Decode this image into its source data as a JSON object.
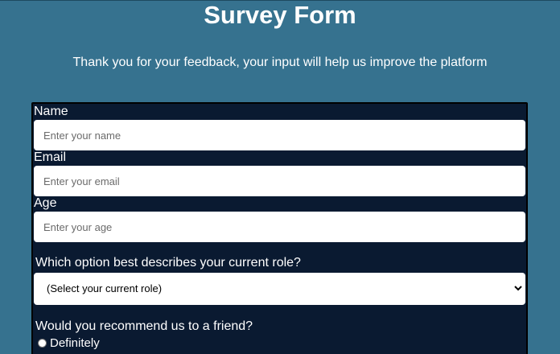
{
  "header": {
    "title": "Survey Form",
    "description": "Thank you for your feedback, your input will help us improve the platform"
  },
  "form": {
    "name": {
      "label": "Name",
      "placeholder": "Enter your name"
    },
    "email": {
      "label": "Email",
      "placeholder": "Enter your email"
    },
    "age": {
      "label": "Age",
      "placeholder": "Enter your age"
    },
    "role": {
      "question": "Which option best describes your current role?",
      "selected": "(Select your current role)"
    },
    "recommend": {
      "question": "Would you recommend us to a friend?",
      "options": [
        "Definitely"
      ]
    }
  },
  "colors": {
    "page_background": "#36728f",
    "form_background": "#0a1a31"
  }
}
